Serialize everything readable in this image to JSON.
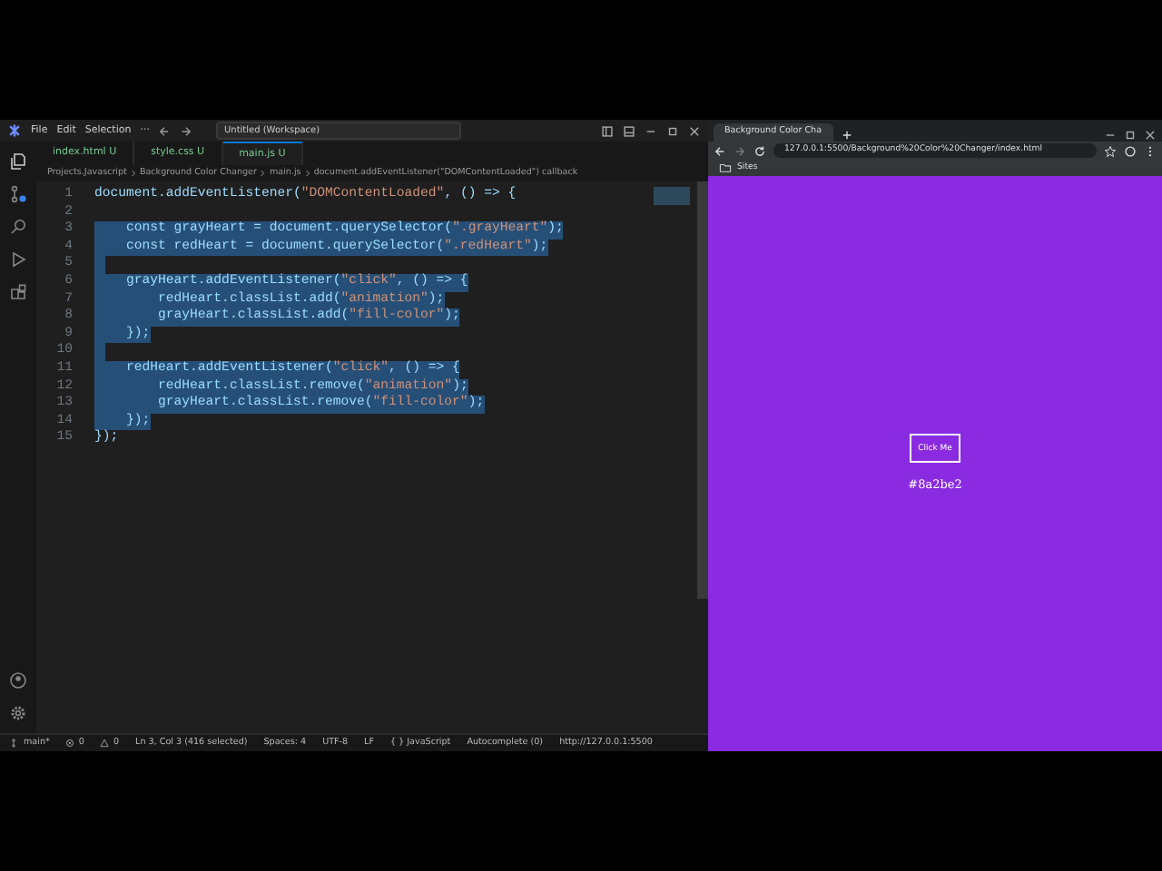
{
  "editor": {
    "menu": [
      "File",
      "Edit",
      "Selection",
      "···"
    ],
    "title": "Untitled (Workspace)",
    "tabs": [
      {
        "label": "index.html",
        "status": "U",
        "selected": false
      },
      {
        "label": "style.css",
        "status": "U",
        "selected": false
      },
      {
        "label": "main.js",
        "status": "U",
        "selected": true
      }
    ],
    "breadcrumb": [
      "Projects.Javascript",
      "Background Color Changer",
      "main.js",
      "document.addEventListener(\"DOMContentLoaded\") callback"
    ],
    "lines": [
      {
        "number": "1",
        "code": "document.addEventListener(\"DOMContentLoaded\", () => {",
        "selected": false
      },
      {
        "number": "2",
        "selected": false
      },
      {
        "number": "3",
        "code": "    const grayHeart = document.querySelector(\".grayHeart\");",
        "selected": true
      },
      {
        "number": "4",
        "code": "    const redHeart = document.querySelector(\".redHeart\");",
        "selected": true
      },
      {
        "number": "5",
        "selected": true
      },
      {
        "number": "6",
        "code": "    grayHeart.addEventListener(\"click\", () => {",
        "selected": true
      },
      {
        "number": "7",
        "code": "        redHeart.classList.add(\"animation\");",
        "selected": true
      },
      {
        "number": "8",
        "code": "        grayHeart.classList.add(\"fill-color\");",
        "selected": true
      },
      {
        "number": "9",
        "code": "    });",
        "selected": true
      },
      {
        "number": "10",
        "selected": true
      },
      {
        "number": "11",
        "code": "    redHeart.addEventListener(\"click\", () => {",
        "selected": true
      },
      {
        "number": "12",
        "code": "        redHeart.classList.remove(\"animation\");",
        "selected": true
      },
      {
        "number": "13",
        "code": "        grayHeart.classList.remove(\"fill-color\");",
        "selected": true
      },
      {
        "number": "14",
        "code": "    });",
        "selected": true
      },
      {
        "number": "15",
        "code": "});",
        "selected": false
      }
    ],
    "status_bar": {
      "branch": "main*",
      "errors": "0",
      "warnings": "0",
      "items": [
        "Ln 3, Col 3 (416 selected)",
        "Spaces: 4",
        "UTF-8",
        "LF",
        "{ } JavaScript",
        "Autocomplete (0)"
      ],
      "live_server": "http://127.0.0.1:5500"
    }
  },
  "browser": {
    "tab": "Background Color Cha",
    "url": "127.0.0.1:5500/Background%20Color%20Changer/index.html",
    "bookmark": "Sites",
    "button": "Click Me",
    "color_label": "#8a2be2"
  }
}
